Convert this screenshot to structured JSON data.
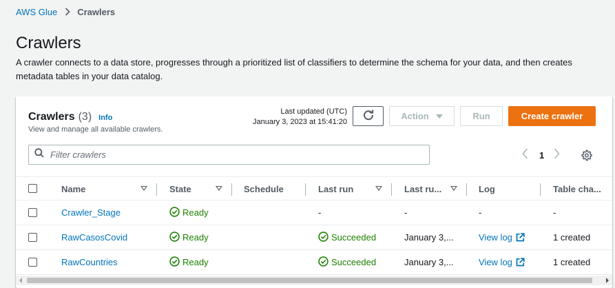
{
  "breadcrumb": {
    "root": "AWS Glue",
    "current": "Crawlers"
  },
  "page": {
    "title": "Crawlers",
    "description": "A crawler connects to a data store, progresses through a prioritized list of classifiers to determine the schema for your data, and then creates metadata tables in your data catalog."
  },
  "panel": {
    "title": "Crawlers",
    "count": "(3)",
    "info": "Info",
    "subtitle": "View and manage all available crawlers.",
    "last_updated_label": "Last updated (UTC)",
    "last_updated_value": "January 3, 2023 at 15:41:20",
    "action_label": "Action",
    "run_label": "Run",
    "create_label": "Create crawler",
    "filter_placeholder": "Filter crawlers",
    "page_number": "1"
  },
  "table": {
    "columns": [
      "Name",
      "State",
      "Schedule",
      "Last run",
      "Last ru...",
      "Log",
      "Table cha..."
    ],
    "rows": [
      {
        "name": "Crawler_Stage",
        "state": "Ready",
        "schedule": "",
        "last_run": "-",
        "last_run_time": "-",
        "log": "-",
        "table_changes": "-"
      },
      {
        "name": "RawCasosCovid",
        "state": "Ready",
        "schedule": "",
        "last_run": "Succeeded",
        "last_run_time": "January 3,...",
        "log": "View log",
        "table_changes": "1 created"
      },
      {
        "name": "RawCountries",
        "state": "Ready",
        "schedule": "",
        "last_run": "Succeeded",
        "last_run_time": "January 3,...",
        "log": "View log",
        "table_changes": "1 created"
      }
    ]
  },
  "colors": {
    "accent": "#ec7211",
    "link": "#0073bb",
    "success": "#1d8102"
  }
}
